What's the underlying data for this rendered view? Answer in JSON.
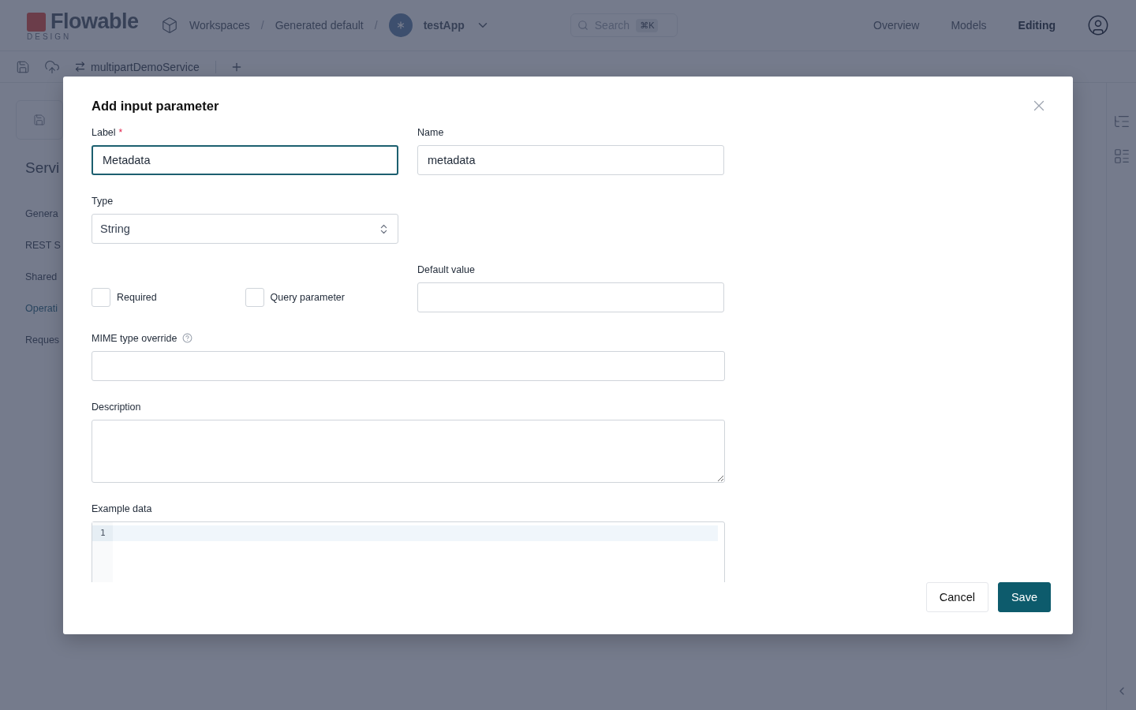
{
  "header": {
    "logo": {
      "name": "Flowable",
      "sub": "DESIGN"
    },
    "breadcrumbs": [
      {
        "label": "Workspaces",
        "kind": "workspaces"
      },
      {
        "label": "Generated default",
        "kind": "plain"
      },
      {
        "label": "testApp",
        "kind": "app"
      }
    ],
    "separator": "/",
    "search": {
      "placeholder": "Search",
      "shortcut": "⌘K"
    },
    "nav": [
      {
        "label": "Overview",
        "selected": false
      },
      {
        "label": "Models",
        "selected": false
      },
      {
        "label": "Editing",
        "selected": true
      }
    ]
  },
  "tabs": [
    {
      "label": "multipartDemoService"
    }
  ],
  "sidebar": {
    "title": "Servi",
    "items": [
      {
        "label": "Genera",
        "selected": false
      },
      {
        "label": "REST S",
        "selected": false
      },
      {
        "label": "Shared",
        "selected": false
      },
      {
        "label": "Operati",
        "selected": true
      },
      {
        "label": "Reques",
        "selected": false
      }
    ]
  },
  "dialog": {
    "title": "Add input parameter",
    "label_field": {
      "label": "Label",
      "required_mark": "*",
      "value": "Metadata",
      "focused": true
    },
    "name_field": {
      "label": "Name",
      "value": "metadata",
      "focused": false
    },
    "type_select": {
      "label": "Type",
      "value": "String"
    },
    "checkboxes": [
      {
        "label": "Required",
        "checked": false
      },
      {
        "label": "Query parameter",
        "checked": false
      }
    ],
    "default_value": {
      "label": "Default value"
    },
    "mime_type": {
      "label": "MIME type override"
    },
    "description": {
      "label": "Description"
    },
    "example_data": {
      "label": "Example data",
      "line_numbers": [
        "1"
      ]
    },
    "buttons": [
      {
        "label": "Cancel",
        "kind": "secondary"
      },
      {
        "label": "Save",
        "kind": "primary"
      }
    ]
  }
}
